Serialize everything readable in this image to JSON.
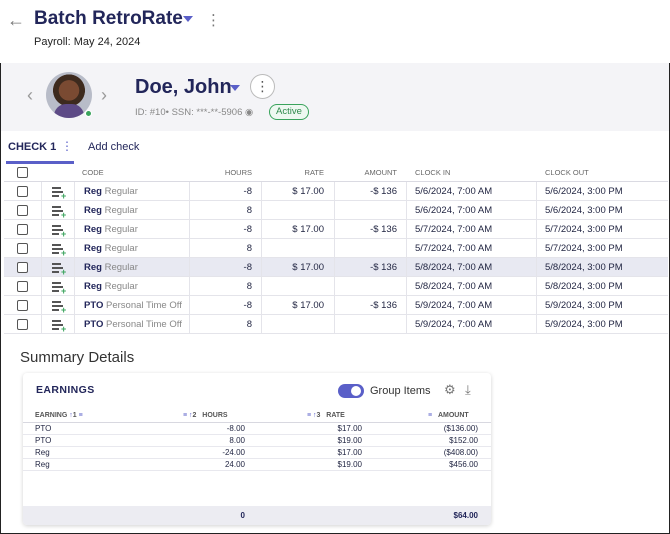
{
  "header": {
    "title": "Batch RetroRate",
    "subtitle": "Payroll: May 24, 2024"
  },
  "employee": {
    "name": "Doe, John",
    "id_ssn": "ID: #10• SSN: ***-**-5906",
    "status": "Active"
  },
  "tabs": {
    "check": "CHECK 1",
    "add": "Add check"
  },
  "grid": {
    "columns": [
      "CODE",
      "HOURS",
      "RATE",
      "AMOUNT",
      "CLOCK IN",
      "CLOCK OUT"
    ],
    "rows": [
      {
        "code": "Reg",
        "desc": "Regular",
        "hours": "-8",
        "rate": "$ 17.00",
        "amount": "-$ 136",
        "clock_in": "5/6/2024, 7:00 AM",
        "clock_out": "5/6/2024, 3:00 PM"
      },
      {
        "code": "Reg",
        "desc": "Regular",
        "hours": "8",
        "rate": "",
        "amount": "",
        "clock_in": "5/6/2024, 7:00 AM",
        "clock_out": "5/6/2024, 3:00 PM"
      },
      {
        "code": "Reg",
        "desc": "Regular",
        "hours": "-8",
        "rate": "$ 17.00",
        "amount": "-$ 136",
        "clock_in": "5/7/2024, 7:00 AM",
        "clock_out": "5/7/2024, 3:00 PM"
      },
      {
        "code": "Reg",
        "desc": "Regular",
        "hours": "8",
        "rate": "",
        "amount": "",
        "clock_in": "5/7/2024, 7:00 AM",
        "clock_out": "5/7/2024, 3:00 PM"
      },
      {
        "code": "Reg",
        "desc": "Regular",
        "hours": "-8",
        "rate": "$ 17.00",
        "amount": "-$ 136",
        "clock_in": "5/8/2024, 7:00 AM",
        "clock_out": "5/8/2024, 3:00 PM"
      },
      {
        "code": "Reg",
        "desc": "Regular",
        "hours": "8",
        "rate": "",
        "amount": "",
        "clock_in": "5/8/2024, 7:00 AM",
        "clock_out": "5/8/2024, 3:00 PM"
      },
      {
        "code": "PTO",
        "desc": "Personal Time Off",
        "hours": "-8",
        "rate": "$ 17.00",
        "amount": "-$ 136",
        "clock_in": "5/9/2024, 7:00 AM",
        "clock_out": "5/9/2024, 3:00 PM"
      },
      {
        "code": "PTO",
        "desc": "Personal Time Off",
        "hours": "8",
        "rate": "",
        "amount": "",
        "clock_in": "5/9/2024, 7:00 AM",
        "clock_out": "5/9/2024, 3:00 PM"
      }
    ],
    "selected_row": 4
  },
  "summary": {
    "title": "Summary Details",
    "card_title": "EARNINGS",
    "group_label": "Group Items",
    "group_on": true,
    "headers": {
      "earning": "EARNING",
      "earning_sort": "1",
      "hours": "HOURS",
      "hours_sort": "2",
      "rate_sort": "3",
      "rate": "RATE",
      "amount": "AMOUNT"
    },
    "rows": [
      {
        "earning": "PTO",
        "hours": "-8.00",
        "rate": "$17.00",
        "amount": "($136.00)"
      },
      {
        "earning": "PTO",
        "hours": "8.00",
        "rate": "$19.00",
        "amount": "$152.00"
      },
      {
        "earning": "Reg",
        "hours": "-24.00",
        "rate": "$17.00",
        "amount": "($408.00)"
      },
      {
        "earning": "Reg",
        "hours": "24.00",
        "rate": "$19.00",
        "amount": "$456.00"
      }
    ],
    "totals": {
      "hours": "0",
      "amount": "$64.00"
    }
  },
  "colors": {
    "accent": "#5a5fc8",
    "title": "#22265a",
    "active": "#3aa35c"
  },
  "icons": [
    "back-arrow-icon",
    "chevron-down-icon",
    "kebab-icon",
    "chevron-left-icon",
    "chevron-right-icon",
    "eye-icon",
    "row-add-icon",
    "filter-icon",
    "sort-up-icon",
    "gear-icon",
    "download-icon"
  ]
}
